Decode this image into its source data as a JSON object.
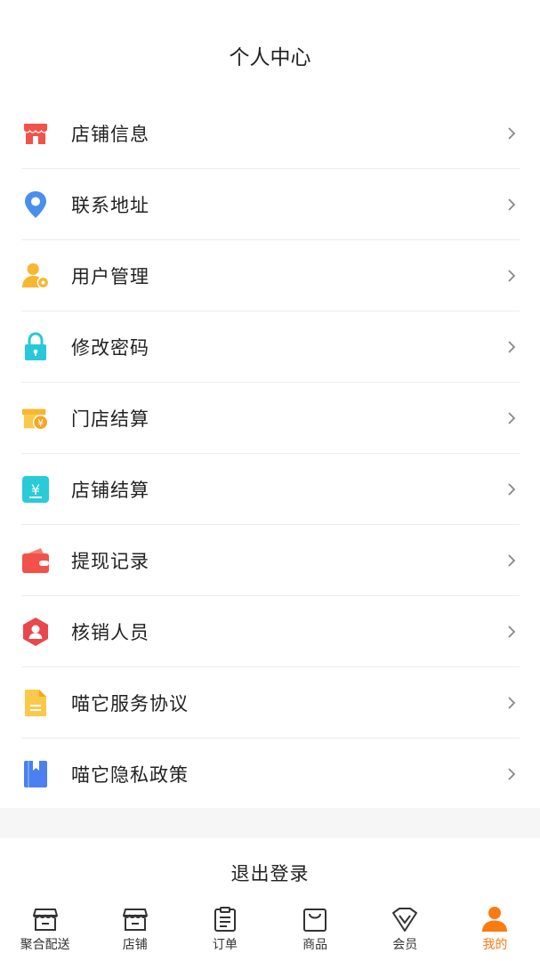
{
  "header": {
    "title": "个人中心"
  },
  "menu": {
    "items": [
      {
        "label": "店铺信息",
        "icon": "store-icon"
      },
      {
        "label": "联系地址",
        "icon": "location-pin-icon"
      },
      {
        "label": "用户管理",
        "icon": "user-settings-icon"
      },
      {
        "label": "修改密码",
        "icon": "lock-icon"
      },
      {
        "label": "门店结算",
        "icon": "store-yuan-icon"
      },
      {
        "label": "店铺结算",
        "icon": "yuan-document-icon"
      },
      {
        "label": "提现记录",
        "icon": "wallet-icon"
      },
      {
        "label": "核销人员",
        "icon": "hexagon-user-icon"
      },
      {
        "label": "喵它服务协议",
        "icon": "document-icon"
      },
      {
        "label": "喵它隐私政策",
        "icon": "bookmark-book-icon"
      }
    ]
  },
  "logout": {
    "label": "退出登录"
  },
  "tabbar": {
    "items": [
      {
        "label": "聚合配送",
        "icon": "store-outline-icon"
      },
      {
        "label": "店铺",
        "icon": "shop-outline-icon"
      },
      {
        "label": "订单",
        "icon": "clipboard-icon"
      },
      {
        "label": "商品",
        "icon": "shopping-bag-icon"
      },
      {
        "label": "会员",
        "icon": "vip-diamond-icon"
      },
      {
        "label": "我的",
        "icon": "person-icon",
        "active": true
      }
    ]
  },
  "colors": {
    "accent": "#f97b12",
    "divider": "#ececec",
    "section_gap": "#f6f6f6"
  }
}
